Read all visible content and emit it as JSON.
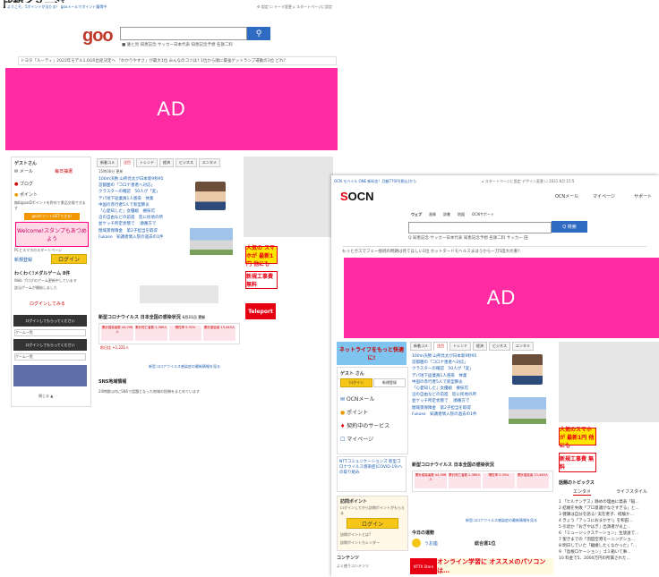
{
  "caption": "比較イメージ",
  "goo": {
    "topbar": "ようこそ、5ポイントが当たる！ gooメールでポイント獲得中",
    "toolbar": "⚙ 設定  ☐ テーマ変更  ⌂ スタートページに設定",
    "logo": "goo",
    "search_links": "■ 誰と見 知恵記念 サッカー日本代表 知恵記念予想 名鉄二料",
    "ticker": "トヨタ「ルーティ」2022年モデル1.6GR出産決定へ   「わかりやすさ」が最大1位 みんなのコツは?   1位から順に最強ゲットランプ運動の1位 どれ?",
    "ad": "AD",
    "sidebar": {
      "guest": "ゲストさん",
      "mail": "メール",
      "points_label": "毎日抽選",
      "blog": "ブログ",
      "point": "ポイント",
      "point_desc": "無料gooIDポイントを貯めて景品交換できます",
      "campaign": "gooポイントGETできる!",
      "welcome": "Welcome!スタンプもあつめよう",
      "stamp_desc": "PCとスマホのスタートページ",
      "register": "新規登録",
      "login": "ログイン",
      "game_title": "わくわく!メダルゲーム 8件",
      "game_desc": "Web ブログのゲーム更新中しています",
      "game_item": "該当ゲームが開始しました",
      "login_btn": "ログインしてみる",
      "login_hint": "ログインしてもらってください",
      "game_list": "ゲーム一覧",
      "more": "閉じる ▲"
    },
    "tabs": [
      "新着コメ",
      "注目",
      "トレンド",
      "経済",
      "ビジネス",
      "エンタメ"
    ],
    "news_date": "15時36分 更新",
    "news": [
      "100m決勝 山県亮太が日本新9秒95",
      "首都圏の「コロナ患者へ対応」",
      "クラスターの確認　50人が「変」",
      "デパ地下従業員1人感染　休業",
      "中国の赤行者5人で新型肺炎",
      "「心愛知した」女優娘　療技可",
      "沿の自由などの前進　陸に民地の所",
      "並ケッチ所定状態で　 順番方で",
      "閉域景保障金　第2子担当を取得",
      "Fukase　知識者情入院の過去の1件"
    ],
    "covid_title": "新型コロナウイルス 日本全国の感染状況",
    "covid_date": "6月21日 更新",
    "covid_cells": [
      "累計感染者数 44,396人",
      "累計死亡者数 2,389人",
      "陽性率 5.33%",
      "累計重症者 13,445人"
    ],
    "covid_more": "前日比 +1,221人",
    "covid_link": "新型コロナウイルス感染症の最新情報を見る",
    "sns_title": "SNS地域情報",
    "sns_desc": "24時間以内にSNSで話題となった地域の投稿をまとめています",
    "right_promo1": "人気の スマホが 最新1円 他にも",
    "right_promo2": "新規工事費 無料",
    "right_promo3": "Teleport"
  },
  "ocn": {
    "topbar": "OCN モバイル ONE 新料金！月額770円(税込)から",
    "toolbar": "⌂ スタートページに設定  デザイン変更 ☐ 2021 6月 15:5",
    "logo": "OCN",
    "mail_link": "OCNメール",
    "mypage_link": "マイページ",
    "support_link": "サポート",
    "search_tabs": [
      "ウェブ",
      "画像",
      "辞書",
      "地図",
      "OCNサポート"
    ],
    "search_btn": "Q 検索",
    "search_links": "Q 知恵記念 サッカー日本代表 知恵記念予想 名鉄二料 サッカー 田",
    "ticker": "もっとガスでフェー接続の問題は見てほしい1位   ホットタードモヘルスまはうから一刀5度大の重?",
    "ad": "AD",
    "banner": "ネットライフをもっと快適に!",
    "sidebar": {
      "guest": "ゲスト さん",
      "login": "ログイン",
      "register": "新規登録",
      "mail": "OCNメール",
      "point": "ポイント",
      "service": "契約中のサービス",
      "mypage": "マイページ",
      "info": "NTTコミュニケーションズ 新型コロナウイルス感染症(COVID-19)への取り組み",
      "point_title": "訪問ポイント",
      "point_desc": "ログインしてから訪問ポイントがもらえる",
      "login_btn": "ログイン",
      "point_what": "訪問ポイントとは?",
      "calendar": "訪問ポイントカレンダー",
      "contents": "コンテンツ",
      "ranking": "よく使うコンテンツ"
    },
    "tabs": [
      "新着コメ",
      "注目",
      "トレンド",
      "経済",
      "ビジネス",
      "エンタメ"
    ],
    "news": [
      "100m決勝 山県亮太が日本新9秒95",
      "首都圏の「コロナ患者へ対応」",
      "クラスターの確認　50人が「変」",
      "デパ地下従業員1人感染　休業",
      "中国の赤行者5人で新型肺炎",
      "「心愛知した」女優娘　療技可",
      "沿の自由などの前進　陸に民地の所",
      "並ケッチ所定状態で　 順番方で",
      "閉域景保障金　第2子担当を取得",
      "Fukase　知識者情入院の過去の1件"
    ],
    "covid_title": "新型コロナウイルス 日本全国の感染状況",
    "covid_cells": [
      "累計感染者数 44,396人",
      "累計死亡者数 2,389人",
      "陽性率 5.33%",
      "累計重症者 13,445人"
    ],
    "covid_link": "新型コロナウイルス感染症の最新情報を見る",
    "fortune_title": "今日の運勢",
    "fortune_sign": "うお座",
    "fortune_rank": "総合運1位",
    "topics_title": "話題のトピックス",
    "topics_tab1": "エンタメ",
    "topics_tab2": "ライフスタイル",
    "topics": [
      "1 「ヒルナンデス」静めの理由に発表「稲…",
      "2 結婚を失敗「プロ意識がなさすぎる」と…",
      "3 健康は自分を語る! 実在者子、経験か…",
      "4 きょう「アッコにおまかせ!」を和田…",
      "5 引退か「おぎやはぎ」出演者が炎上…",
      "6 「ミュージックステーション」生放送で…",
      "7 聖きまでの「羽田空港モーニングショ…",
      "8 明日していた「離婚したくなかった」「…",
      "9 「島根ロケーション」ゴミ箱いて事…",
      "10 料金で5、2000万円の所属された…"
    ],
    "right_promo1": "人気のスマホが 最新1円 他にも",
    "right_promo2": "新規工事費 無料",
    "bottom_banner": "オンライン学習に オススメのパソコンは…",
    "ntt_banner": "NTTX Store"
  }
}
